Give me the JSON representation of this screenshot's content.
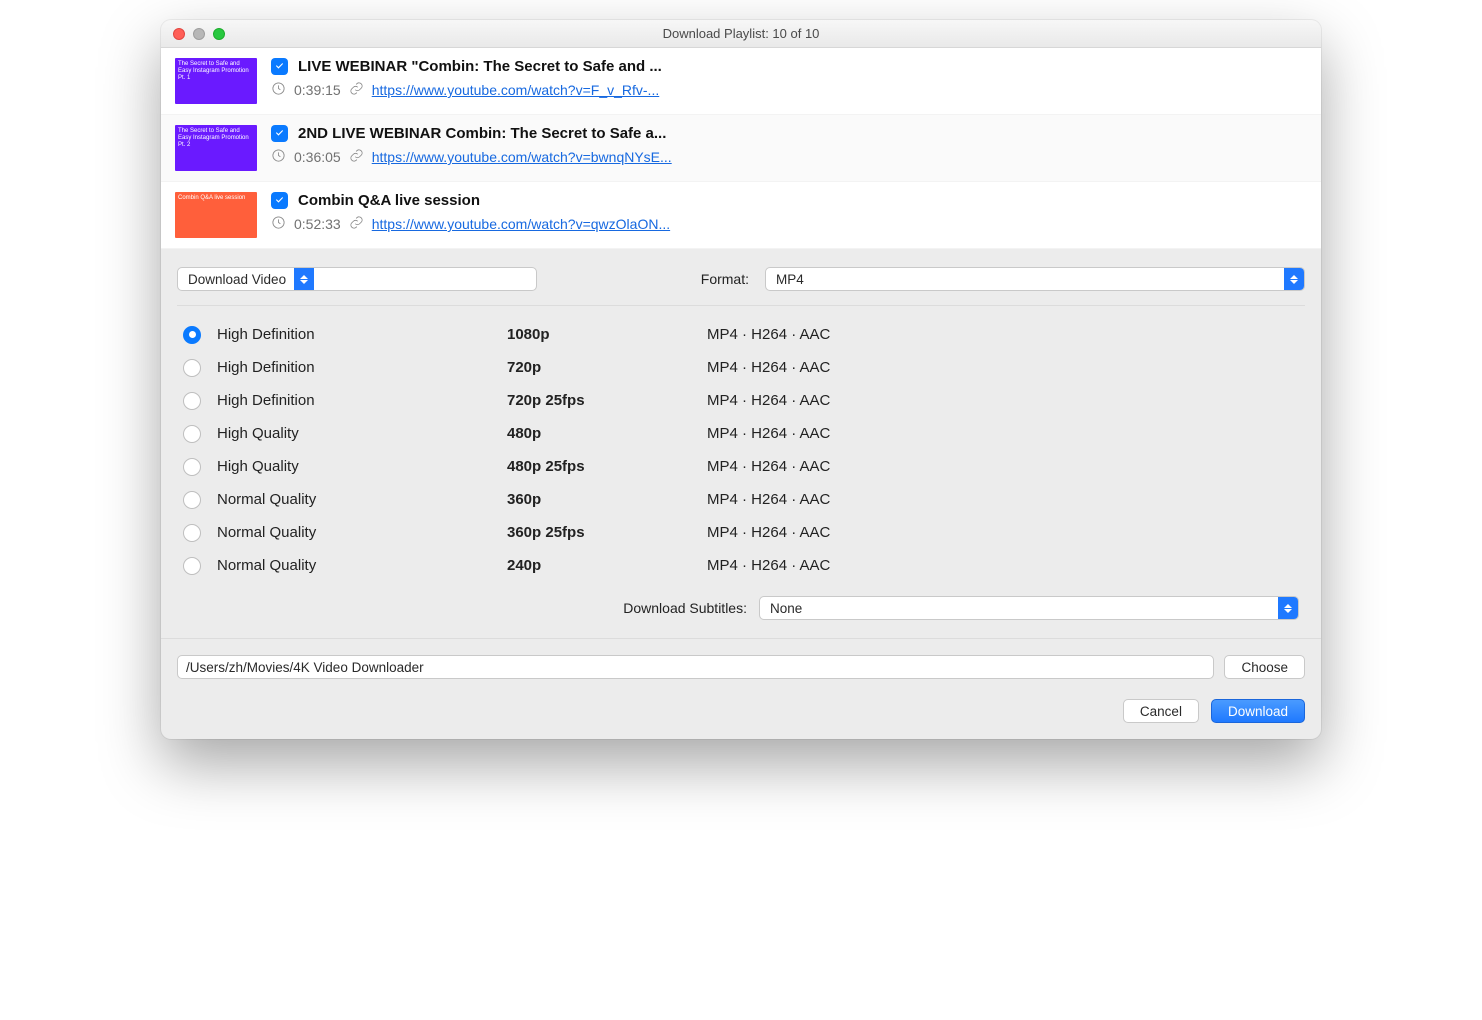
{
  "window": {
    "title": "Download Playlist: 10 of 10"
  },
  "videos": [
    {
      "title": "LIVE WEBINAR \"Combin: The Secret to Safe and ...",
      "duration": "0:39:15",
      "url": "https://www.youtube.com/watch?v=F_v_Rfv-...",
      "thumb_text": "The Secret to Safe and Easy Instagram Promotion Pt. 1",
      "thumb_variant": "purple",
      "checked": true
    },
    {
      "title": "2ND LIVE WEBINAR Combin: The Secret to Safe a...",
      "duration": "0:36:05",
      "url": "https://www.youtube.com/watch?v=bwnqNYsE...",
      "thumb_text": "The Secret to Safe and Easy Instagram Promotion Pt. 2",
      "thumb_variant": "purple",
      "checked": true
    },
    {
      "title": "Combin Q&A live session",
      "duration": "0:52:33",
      "url": "https://www.youtube.com/watch?v=qwzOlaON...",
      "thumb_text": "Combin Q&A live session",
      "thumb_variant": "orange",
      "checked": true
    }
  ],
  "mode_select": {
    "value": "Download Video"
  },
  "format_label": "Format:",
  "format_select": {
    "value": "MP4"
  },
  "qualities": [
    {
      "label": "High Definition",
      "res": "1080p",
      "codec": "MP4 · H264 · AAC",
      "selected": true
    },
    {
      "label": "High Definition",
      "res": "720p",
      "codec": "MP4 · H264 · AAC",
      "selected": false
    },
    {
      "label": "High Definition",
      "res": "720p 25fps",
      "codec": "MP4 · H264 · AAC",
      "selected": false
    },
    {
      "label": "High Quality",
      "res": "480p",
      "codec": "MP4 · H264 · AAC",
      "selected": false
    },
    {
      "label": "High Quality",
      "res": "480p 25fps",
      "codec": "MP4 · H264 · AAC",
      "selected": false
    },
    {
      "label": "Normal Quality",
      "res": "360p",
      "codec": "MP4 · H264 · AAC",
      "selected": false
    },
    {
      "label": "Normal Quality",
      "res": "360p 25fps",
      "codec": "MP4 · H264 · AAC",
      "selected": false
    },
    {
      "label": "Normal Quality",
      "res": "240p",
      "codec": "MP4 · H264 · AAC",
      "selected": false
    }
  ],
  "subs_label": "Download Subtitles:",
  "subs_select": {
    "value": "None"
  },
  "path": "/Users/zh/Movies/4K Video Downloader",
  "buttons": {
    "choose": "Choose",
    "cancel": "Cancel",
    "download": "Download"
  }
}
